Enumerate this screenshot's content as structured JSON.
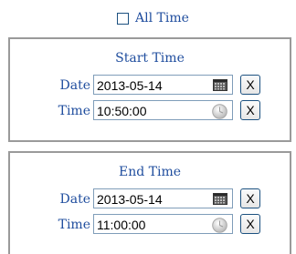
{
  "all_time": {
    "label": "All Time",
    "checked": false
  },
  "start": {
    "title": "Start Time",
    "date_label": "Date",
    "date_value": "2013-05-14",
    "time_label": "Time",
    "time_value": "10:50:00",
    "clear_label": "X"
  },
  "end": {
    "title": "End Time",
    "date_label": "Date",
    "date_value": "2013-05-14",
    "time_label": "Time",
    "time_value": "11:00:00",
    "clear_label": "X"
  },
  "icons": {
    "date_picker": "calendar-icon",
    "time_picker": "clock-icon"
  },
  "colors": {
    "label_blue": "#1f4d9e",
    "border_gray": "#9a9a9a",
    "button_border": "#1c5180"
  }
}
